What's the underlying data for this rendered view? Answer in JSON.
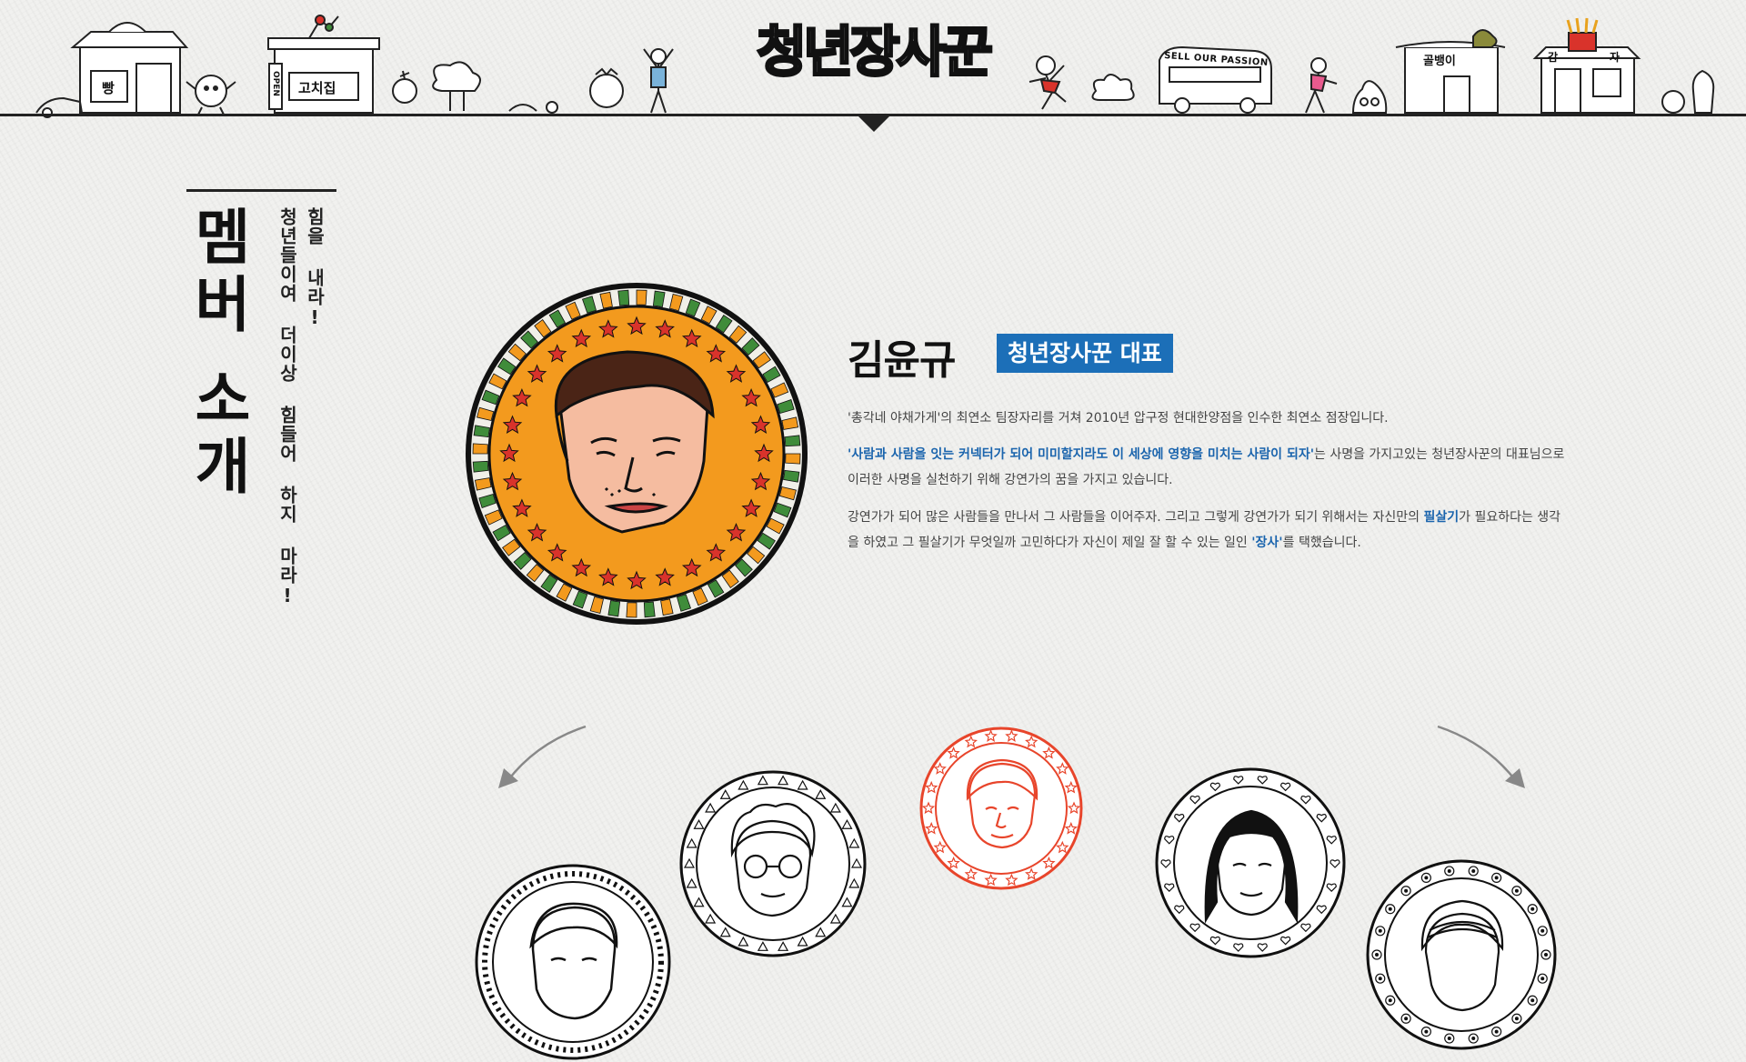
{
  "header": {
    "logo": "청년장사꾼",
    "signs": {
      "bread": "빵",
      "open": "OPEN",
      "goguma": "고치집",
      "bus": "SELL OUR PASSION",
      "snail": "골뱅이",
      "potato_left": "감",
      "potato_right": "자"
    }
  },
  "section": {
    "title_chars": [
      "멤",
      "버",
      "소",
      "개"
    ],
    "slogan_line1": "힘을 내라!",
    "slogan_line2": "청년들이여 더이상 힘들어 하지 마라!"
  },
  "featured": {
    "name": "김윤규",
    "role": "청년장사꾼 대표",
    "bio1": "'총각네 야채가게'의 최연소 팀장자리를 거쳐 2010년 압구정 현대한양점을 인수한 최연소 점장입니다.",
    "bio2_highlight": "'사람과 사람을 잇는 커넥터가 되어 미미할지라도 이 세상에 영향을 미치는 사람이 되자'",
    "bio2_rest": "는 사명을 가지고있는 청년장사꾼의 대표님으로 이러한 사명을 실천하기 위해 강연가의 꿈을 가지고 있습니다.",
    "bio3_a": "강연가가 되어 많은 사람들을 만나서 그 사람들을 이어주자. 그리고 그렇게 강연가가 되기 위해서는 자신만의 ",
    "bio3_b": "필살기",
    "bio3_c": "가 필요하다는 생각을 하였고 그 필살기가 무엇일까 고민하다가 자신이 제일 잘 할 수 있는 일인 ",
    "bio3_d": "'장사'",
    "bio3_e": "를 택했습니다."
  },
  "colors": {
    "accent_blue": "#1c6fb8",
    "coin_orange": "#f39a1e",
    "coin_green": "#3f8c3a",
    "coin_red": "#d9332b",
    "selected_red": "#e8452b",
    "ink": "#111111"
  },
  "carousel": {
    "members": [
      "member-1",
      "member-2",
      "member-3",
      "member-4",
      "member-5"
    ],
    "selected_index": 2
  }
}
